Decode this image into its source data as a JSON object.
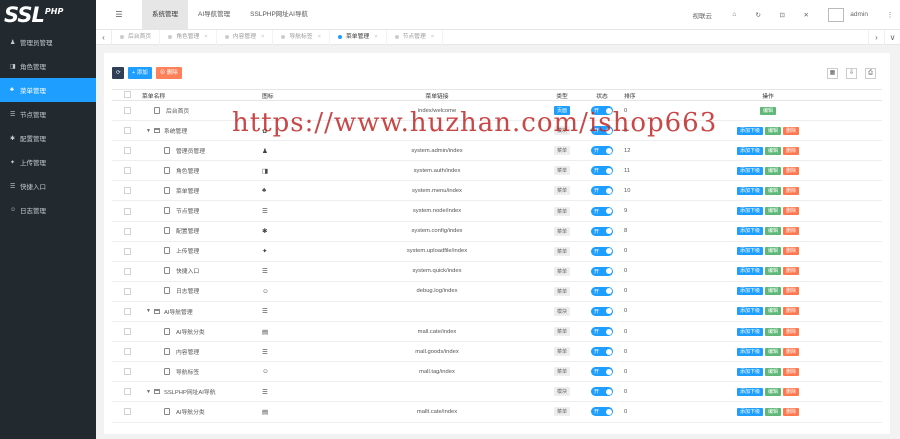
{
  "logo": {
    "main": "SSL",
    "sub": "PHP"
  },
  "sidebar": {
    "items": [
      {
        "label": "管理员管理",
        "icon": "user-icon",
        "glyph": "♟",
        "active": false
      },
      {
        "label": "角色管理",
        "icon": "role-icon",
        "glyph": "◨",
        "active": false
      },
      {
        "label": "菜单管理",
        "icon": "bell-icon",
        "glyph": "♣",
        "active": true
      },
      {
        "label": "节点管理",
        "icon": "list-icon",
        "glyph": "☰",
        "active": false
      },
      {
        "label": "配置管理",
        "icon": "gear-icon",
        "glyph": "✱",
        "active": false
      },
      {
        "label": "上传管理",
        "icon": "upload-icon",
        "glyph": "✦",
        "active": false
      },
      {
        "label": "快捷入口",
        "icon": "list-icon",
        "glyph": "☰",
        "active": false
      },
      {
        "label": "日志管理",
        "icon": "smile-icon",
        "glyph": "☺",
        "active": false
      }
    ]
  },
  "header": {
    "menu_icon": "☰",
    "tabs": [
      {
        "label": "系统管理",
        "active": true
      },
      {
        "label": "AI导航管理",
        "active": false
      },
      {
        "label": "SSLPHP网址AI导航",
        "active": false
      }
    ],
    "right": {
      "sdk": "视联云",
      "home": "⌂",
      "refresh": "↻",
      "clear": "⊡",
      "fullscreen": "✕",
      "user": "admin",
      "more": "⋮"
    }
  },
  "pagetabs": {
    "left": "‹",
    "right1": "›",
    "right2": "∨",
    "items": [
      {
        "label": "后台首页",
        "active": false,
        "closable": false
      },
      {
        "label": "角色管理",
        "active": false,
        "closable": true
      },
      {
        "label": "内容管理",
        "active": false,
        "closable": true
      },
      {
        "label": "导航标签",
        "active": false,
        "closable": true
      },
      {
        "label": "菜单管理",
        "active": true,
        "closable": true
      },
      {
        "label": "节点管理",
        "active": false,
        "closable": true
      }
    ]
  },
  "toolbar": {
    "refresh": "⟳",
    "add": "+ 添加",
    "delete": "⊗ 删除",
    "tools": [
      "▦",
      "⇩",
      "⎙"
    ]
  },
  "table": {
    "headers": {
      "name": "菜单名称",
      "icon": "图标",
      "link": "菜单链接",
      "type": "类型",
      "status": "状态",
      "sort": "排序",
      "ops": "操作"
    },
    "status_on": "开",
    "ops": {
      "sub": "添加下级",
      "edit": "编辑",
      "del": "删除"
    },
    "rows": [
      {
        "name": "后台首页",
        "level": 0,
        "kind": "page",
        "icon": "",
        "link": "index/welcome",
        "type": "页面",
        "type_primary": true,
        "sort": "0",
        "ops": [
          "edit"
        ]
      },
      {
        "name": "系统管理",
        "level": 0,
        "kind": "folder",
        "icon": "✿",
        "link": "",
        "type": "模块",
        "type_primary": false,
        "sort": "0",
        "ops": [
          "sub",
          "edit",
          "del"
        ]
      },
      {
        "name": "管理员管理",
        "level": 1,
        "kind": "page",
        "icon": "♟",
        "link": "system.admin/index",
        "type": "菜单",
        "type_primary": false,
        "sort": "12",
        "ops": [
          "sub",
          "edit",
          "del"
        ]
      },
      {
        "name": "角色管理",
        "level": 1,
        "kind": "page",
        "icon": "◨",
        "link": "system.auth/index",
        "type": "菜单",
        "type_primary": false,
        "sort": "11",
        "ops": [
          "sub",
          "edit",
          "del"
        ]
      },
      {
        "name": "菜单管理",
        "level": 1,
        "kind": "page",
        "icon": "♣",
        "link": "system.menu/index",
        "type": "菜单",
        "type_primary": false,
        "sort": "10",
        "ops": [
          "sub",
          "edit",
          "del"
        ]
      },
      {
        "name": "节点管理",
        "level": 1,
        "kind": "page",
        "icon": "☰",
        "link": "system.node/index",
        "type": "菜单",
        "type_primary": false,
        "sort": "9",
        "ops": [
          "sub",
          "edit",
          "del"
        ]
      },
      {
        "name": "配置管理",
        "level": 1,
        "kind": "page",
        "icon": "✱",
        "link": "system.config/index",
        "type": "菜单",
        "type_primary": false,
        "sort": "8",
        "ops": [
          "sub",
          "edit",
          "del"
        ]
      },
      {
        "name": "上传管理",
        "level": 1,
        "kind": "page",
        "icon": "✦",
        "link": "system.uploadfile/index",
        "type": "菜单",
        "type_primary": false,
        "sort": "0",
        "ops": [
          "sub",
          "edit",
          "del"
        ]
      },
      {
        "name": "快捷入口",
        "level": 1,
        "kind": "page",
        "icon": "☰",
        "link": "system.quick/index",
        "type": "菜单",
        "type_primary": false,
        "sort": "0",
        "ops": [
          "sub",
          "edit",
          "del"
        ]
      },
      {
        "name": "日志管理",
        "level": 1,
        "kind": "page",
        "icon": "☺",
        "link": "debug.log/index",
        "type": "菜单",
        "type_primary": false,
        "sort": "0",
        "ops": [
          "sub",
          "edit",
          "del"
        ]
      },
      {
        "name": "AI导航管理",
        "level": 0,
        "kind": "folder",
        "icon": "☰",
        "link": "",
        "type": "模块",
        "type_primary": false,
        "sort": "0",
        "ops": [
          "sub",
          "edit",
          "del"
        ]
      },
      {
        "name": "AI导航分类",
        "level": 1,
        "kind": "page",
        "icon": "▤",
        "link": "mall.cate/index",
        "type": "菜单",
        "type_primary": false,
        "sort": "0",
        "ops": [
          "sub",
          "edit",
          "del"
        ]
      },
      {
        "name": "内容管理",
        "level": 1,
        "kind": "page",
        "icon": "☰",
        "link": "mall.goods/index",
        "type": "菜单",
        "type_primary": false,
        "sort": "0",
        "ops": [
          "sub",
          "edit",
          "del"
        ]
      },
      {
        "name": "导航标签",
        "level": 1,
        "kind": "page",
        "icon": "☺",
        "link": "mall.tag/index",
        "type": "菜单",
        "type_primary": false,
        "sort": "0",
        "ops": [
          "sub",
          "edit",
          "del"
        ]
      },
      {
        "name": "SSLPHP网址AI导航",
        "level": 0,
        "kind": "folder",
        "icon": "☰",
        "link": "",
        "type": "模块",
        "type_primary": false,
        "sort": "0",
        "ops": [
          "sub",
          "edit",
          "del"
        ]
      },
      {
        "name": "AI导航分类",
        "level": 1,
        "kind": "page",
        "icon": "▤",
        "link": "mallt.cate/index",
        "type": "菜单",
        "type_primary": false,
        "sort": "0",
        "ops": [
          "sub",
          "edit",
          "del"
        ]
      }
    ]
  },
  "watermark": "https://www.huzhan.com/ishop663"
}
